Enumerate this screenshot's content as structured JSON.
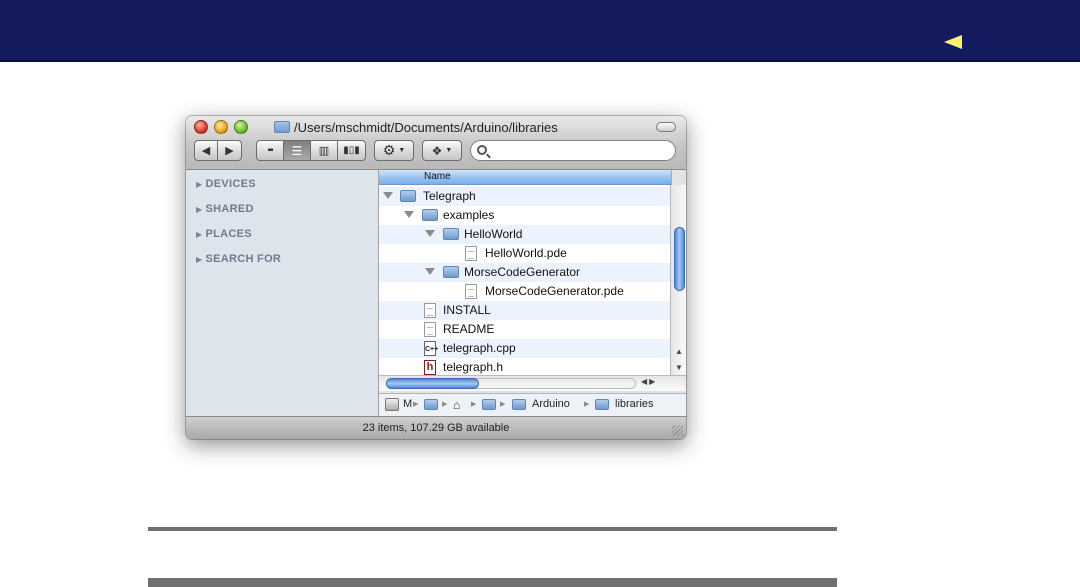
{
  "slide": {
    "back_arrow": "back-arrow-icon",
    "accent": "#fff06a",
    "banner_color": "#131a5e"
  },
  "finder": {
    "title": "/Users/mschmidt/Documents/Arduino/libraries",
    "toolbar": {
      "back": "◀",
      "forward": "▶",
      "views": [
        "icon-view",
        "list-view",
        "column-view",
        "coverflow-view"
      ],
      "action": "gear-icon",
      "dropbox": "dropbox-icon",
      "search_placeholder": ""
    },
    "sidebar": {
      "sections": [
        "DEVICES",
        "SHARED",
        "PLACES",
        "SEARCH FOR"
      ]
    },
    "list": {
      "column_header": "Name",
      "rows": [
        {
          "name": "Telegraph",
          "type": "folder",
          "level": 0,
          "expanded": true
        },
        {
          "name": "examples",
          "type": "folder",
          "level": 1,
          "expanded": true
        },
        {
          "name": "HelloWorld",
          "type": "folder",
          "level": 2,
          "expanded": true
        },
        {
          "name": "HelloWorld.pde",
          "type": "file",
          "level": 3
        },
        {
          "name": "MorseCodeGenerator",
          "type": "folder",
          "level": 2,
          "expanded": true
        },
        {
          "name": "MorseCodeGenerator.pde",
          "type": "file",
          "level": 3
        },
        {
          "name": "INSTALL",
          "type": "file",
          "level": 1
        },
        {
          "name": "README",
          "type": "file",
          "level": 1
        },
        {
          "name": "telegraph.cpp",
          "type": "cpp",
          "level": 1
        },
        {
          "name": "telegraph.h",
          "type": "h",
          "level": 1
        }
      ]
    },
    "pathbar": {
      "first": "M",
      "crumbs": [
        "Arduino",
        "libraries"
      ]
    },
    "status": "23 items, 107.29 GB available"
  }
}
